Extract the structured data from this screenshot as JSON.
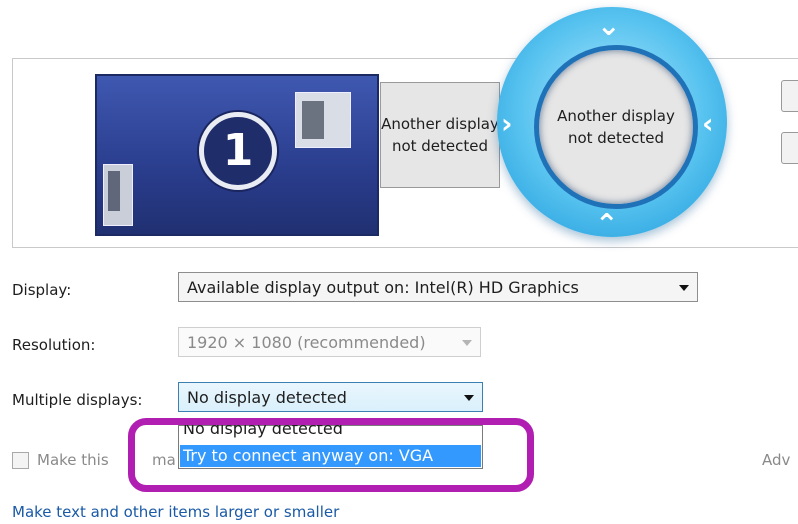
{
  "monitors": [
    {
      "number": "1"
    },
    {
      "label": "Another display not detected"
    },
    {
      "label": "Another display not detected"
    }
  ],
  "display": {
    "label": "Display:",
    "value": "Available display output on: Intel(R) HD Graphics"
  },
  "resolution": {
    "label": "Resolution:",
    "value": "1920 × 1080 (recommended)"
  },
  "multiple_displays": {
    "label": "Multiple displays:",
    "value": "No display detected",
    "options": [
      "No display detected",
      "Try to connect anyway on: VGA"
    ],
    "highlighted_option": "Try to connect anyway on: VGA"
  },
  "make_this": {
    "label": "Make this",
    "label_tail": "ma"
  },
  "advanced_link": "Adv",
  "text_size_link": "Make text and other items larger or smaller",
  "colors": {
    "accent": "#3399ff",
    "highlight_ring": "#b01fb1",
    "link": "#1a5aa6"
  }
}
